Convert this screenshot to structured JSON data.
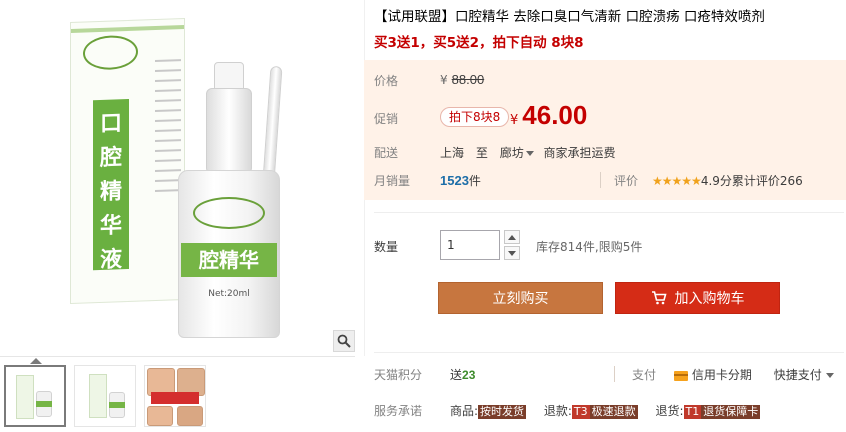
{
  "title": "【试用联盟】口腔精华 去除口臭口气清新 口腔溃疡 口疮特效喷剂",
  "promo_line": "买3送1，买5送2，拍下自动 8块8",
  "gallery": {
    "product_text": {
      "box_seal": "口腔精华液",
      "bottle_band": "腔精华",
      "volume": "Net:20ml"
    }
  },
  "price": {
    "label": "价格",
    "currency": "¥",
    "original": "88.00"
  },
  "promotion": {
    "label": "促销",
    "tag": "拍下8块8",
    "currency": "¥",
    "value": "46.00"
  },
  "shipping": {
    "label": "配送",
    "from": "上海",
    "to_word": "至",
    "destination": "廊坊",
    "fee_note": "商家承担运费"
  },
  "sales": {
    "label": "月销量",
    "count": "1523",
    "unit": "件",
    "rating_label": "评价",
    "stars": "★★★★★",
    "score_text": "4.9分累计评价266"
  },
  "quantity": {
    "label": "数量",
    "value": "1",
    "stock_text": "库存814件,限购5件"
  },
  "buttons": {
    "buy_now": "立刻购买",
    "add_to_cart": "加入购物车"
  },
  "points": {
    "label": "天猫积分",
    "prefix": "送",
    "value": "23"
  },
  "payment": {
    "label": "支付",
    "credit": "信用卡分期",
    "fast": "快捷支付"
  },
  "service": {
    "label": "服务承诺",
    "goods_label": "商品:",
    "goods_tag": "按时发货",
    "refund_label": "退款:",
    "refund_code": "T3",
    "refund_tag": "极速退款",
    "return_label": "退货:",
    "return_code": "T1",
    "return_tag": "退货保障卡"
  },
  "colors": {
    "accent_red": "#c40000",
    "buy_button": "#c7763f",
    "cart_button": "#d52c16",
    "price_panel_bg": "#fff2e8",
    "brand_green": "#76b546"
  }
}
